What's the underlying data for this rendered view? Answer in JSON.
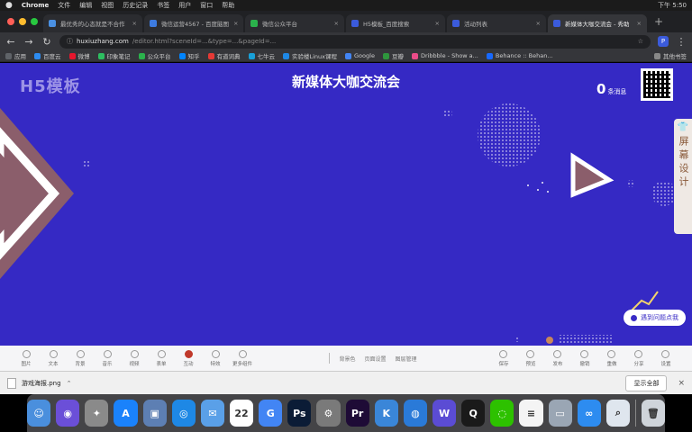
{
  "menubar": {
    "app": "Chrome",
    "items": [
      "文件",
      "编辑",
      "视图",
      "历史记录",
      "书签",
      "用户",
      "窗口",
      "帮助"
    ],
    "clock": "下午 5:50"
  },
  "tabs": [
    {
      "title": "最优秀的心态就是不合作",
      "color": "#4a90e2",
      "active": false
    },
    {
      "title": "微信运营4567 - 百度脑图",
      "color": "#3d7be0",
      "active": false
    },
    {
      "title": "微信公众平台",
      "color": "#2bb24c",
      "active": false
    },
    {
      "title": "H5模板_百度搜索",
      "color": "#3b5bdb",
      "active": false
    },
    {
      "title": "活动列表",
      "color": "#3b5bdb",
      "active": false
    },
    {
      "title": "新媒体大咖交流会 - 秀助",
      "color": "#3b5bdb",
      "active": true
    }
  ],
  "toolbar": {
    "url_host": "huxiuzhang.com",
    "url_rest": "/editor.html?sceneId=...&type=...&pageId=...",
    "avatar_letter": "P"
  },
  "bookmarks": [
    {
      "label": "应用",
      "color": "#5f6368"
    },
    {
      "label": "百度云",
      "color": "#2d8cf0"
    },
    {
      "label": "微博",
      "color": "#e6162d"
    },
    {
      "label": "印象笔记",
      "color": "#2dbe60"
    },
    {
      "label": "公众平台",
      "color": "#2bb24c"
    },
    {
      "label": "知乎",
      "color": "#0084ff"
    },
    {
      "label": "有道词典",
      "color": "#e53935"
    },
    {
      "label": "七牛云",
      "color": "#18a0d8"
    },
    {
      "label": "实验楼Linux课程",
      "color": "#1e88e5"
    },
    {
      "label": "Google",
      "color": "#4285f4"
    },
    {
      "label": "豆瓣",
      "color": "#2e963d"
    },
    {
      "label": "Dribbble - Show a...",
      "color": "#ea4c89"
    },
    {
      "label": "Behance :: Behan...",
      "color": "#1769ff"
    }
  ],
  "bookmarks_right": "其他书签",
  "page": {
    "logo": "H5模板",
    "title": "新媒体大咖交流会",
    "msg_count": "0",
    "msg_label": "条消息",
    "side_panel_text": "屏幕设计",
    "help_text": "遇到问题点我"
  },
  "bottom_tools_left": [
    "图片",
    "文本",
    "背景",
    "音乐",
    "视频",
    "表单",
    "互动",
    "特效",
    "更多组件"
  ],
  "bottom_mid": [
    "背景色",
    "页面设置",
    "图层管理"
  ],
  "bottom_tools_right": [
    "保存",
    "预览",
    "发布",
    "撤销",
    "重做",
    "分享",
    "设置"
  ],
  "download": {
    "filename": "游戏海报.png",
    "show_all": "显示全部"
  },
  "dock_apps": [
    {
      "name": "finder-icon",
      "color": "#4a8fdd",
      "glyph": "☺"
    },
    {
      "name": "siri-icon",
      "color": "#6b4fd8",
      "glyph": "◉"
    },
    {
      "name": "launchpad-icon",
      "color": "#8a8a8a",
      "glyph": "✦"
    },
    {
      "name": "app-store-icon",
      "color": "#1a82fb",
      "glyph": "A"
    },
    {
      "name": "preview-icon",
      "color": "#5d7fb3",
      "glyph": "▣"
    },
    {
      "name": "safari-icon",
      "color": "#1e88e5",
      "glyph": "◎"
    },
    {
      "name": "mail-icon",
      "color": "#5aa0e8",
      "glyph": "✉"
    },
    {
      "name": "calendar-icon",
      "color": "#ffffff",
      "glyph": "22"
    },
    {
      "name": "chrome-icon",
      "color": "#4285f4",
      "glyph": "G"
    },
    {
      "name": "photoshop-icon",
      "color": "#0b1c36",
      "glyph": "Ps"
    },
    {
      "name": "system-preferences-icon",
      "color": "#7a7a7a",
      "glyph": "⚙"
    },
    {
      "name": "premiere-icon",
      "color": "#1e0b36",
      "glyph": "Pr"
    },
    {
      "name": "keynote-icon",
      "color": "#3a86d8",
      "glyph": "K"
    },
    {
      "name": "browser-icon",
      "color": "#2a7ad8",
      "glyph": "◍"
    },
    {
      "name": "wps-icon",
      "color": "#5b4cd4",
      "glyph": "W"
    },
    {
      "name": "qq-icon",
      "color": "#1a1a1a",
      "glyph": "Q"
    },
    {
      "name": "wechat-icon",
      "color": "#2dc100",
      "glyph": "◌"
    },
    {
      "name": "notes-icon",
      "color": "#f4f4f4",
      "glyph": "≡"
    },
    {
      "name": "finder-window-icon",
      "color": "#9aa6b4",
      "glyph": "▭"
    },
    {
      "name": "baidu-netdisk-icon",
      "color": "#2d8cf0",
      "glyph": "∞"
    },
    {
      "name": "preview-search-icon",
      "color": "#dfe6ee",
      "glyph": "⌕"
    },
    {
      "name": "trash-icon",
      "color": "#cfd4da",
      "glyph": "🗑"
    }
  ]
}
